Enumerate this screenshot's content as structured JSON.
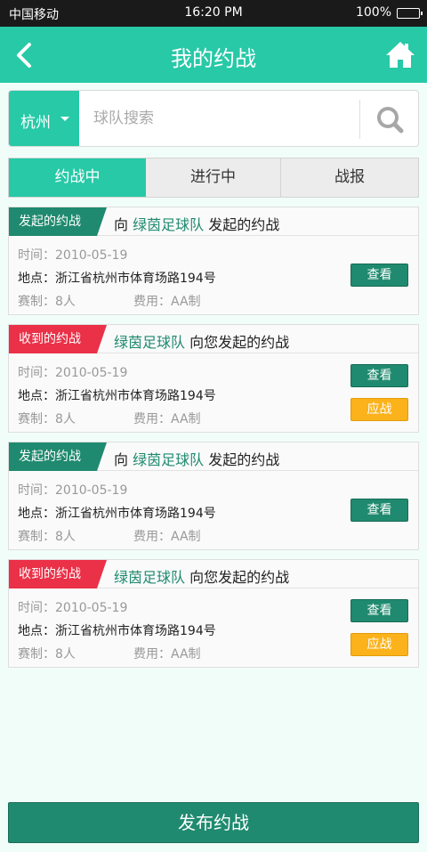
{
  "status_bar": {
    "carrier": "中国移动",
    "time": "16:20 PM",
    "battery": "100%"
  },
  "header": {
    "title": "我的约战",
    "back_icon": "chevron-left-icon",
    "home_icon": "home-icon"
  },
  "search": {
    "city": "杭州",
    "placeholder": "球队搜索",
    "search_icon": "search-icon"
  },
  "tabs": [
    {
      "label": "约战中",
      "active": true
    },
    {
      "label": "进行中"
    },
    {
      "label": "战报"
    }
  ],
  "colors": {
    "accent": "#27c9a7",
    "dark_green": "#1f8a6f",
    "red": "#ea3148",
    "orange": "#fbb21b"
  },
  "cards": [
    {
      "badge": "发起的约战",
      "prefix": "向 ",
      "team": "绿茵足球队",
      "suffix": " 发起的约战",
      "time": "时间：2010-05-19",
      "place": "地点：浙江省杭州市体育场路194号",
      "format": "赛制：8人",
      "fee": "费用：AA制",
      "view_label": "查看"
    },
    {
      "badge": "收到的约战",
      "prefix": "",
      "team": "绿茵足球队",
      "suffix": " 向您发起的约战",
      "time": "时间：2010-05-19",
      "place": "地点：浙江省杭州市体育场路194号",
      "format": "赛制：8人",
      "fee": "费用：AA制",
      "view_label": "查看",
      "accept_label": "应战"
    },
    {
      "badge": "发起的约战",
      "prefix": "向 ",
      "team": "绿茵足球队",
      "suffix": " 发起的约战",
      "time": "时间：2010-05-19",
      "place": "地点：浙江省杭州市体育场路194号",
      "format": "赛制：8人",
      "fee": "费用：AA制",
      "view_label": "查看"
    },
    {
      "badge": "收到的约战",
      "prefix": "",
      "team": "绿茵足球队",
      "suffix": " 向您发起的约战",
      "time": "时间：2010-05-19",
      "place": "地点：浙江省杭州市体育场路194号",
      "format": "赛制：8人",
      "fee": "费用：AA制",
      "view_label": "查看",
      "accept_label": "应战"
    }
  ],
  "publish_label": "发布约战"
}
